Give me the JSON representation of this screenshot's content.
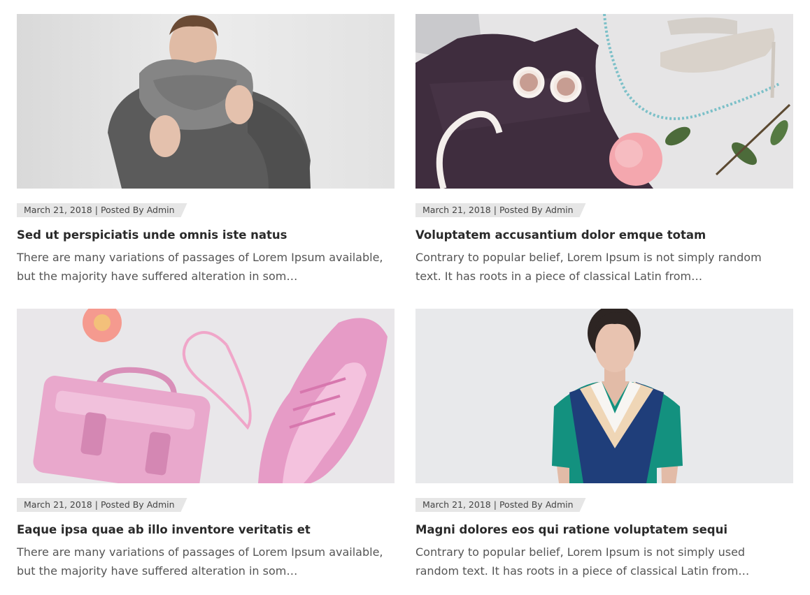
{
  "posts": [
    {
      "image": "man-grey-knit-scarf-photo",
      "date": "March 21, 2018",
      "separator": "|",
      "author_prefix": "Posted By",
      "author": "Admin",
      "title": "Sed ut perspiciatis unde omnis iste natus",
      "excerpt": "There are many variations of passages of Lorem Ipsum available, but the majority have suffered alteration in som…"
    },
    {
      "image": "lace-top-heels-flatlay-photo",
      "date": "March 21, 2018",
      "separator": "|",
      "author_prefix": "Posted By",
      "author": "Admin",
      "title": "Voluptatem accusantium dolor emque totam",
      "excerpt": "Contrary to popular belief, Lorem Ipsum is not simply random text. It has roots in a piece of classical Latin from…"
    },
    {
      "image": "pink-metallic-bag-sneaker-photo",
      "date": "March 21, 2018",
      "separator": "|",
      "author_prefix": "Posted By",
      "author": "Admin",
      "title": "Eaque ipsa quae ab illo inventore veritatis et",
      "excerpt": "There are many variations of passages of Lorem Ipsum available, but the majority have suffered alteration in som…"
    },
    {
      "image": "woman-color-block-dress-photo",
      "date": "March 21, 2018",
      "separator": "|",
      "author_prefix": "Posted By",
      "author": "Admin",
      "title": "Magni dolores eos qui ratione voluptatem sequi",
      "excerpt": "Contrary to popular belief, Lorem Ipsum is not simply used random text. It has roots in a piece of classical Latin from…"
    }
  ],
  "colors": {
    "meta_background": "#e6e6e6",
    "title_text": "#2a2a2a",
    "body_text": "#555555"
  }
}
